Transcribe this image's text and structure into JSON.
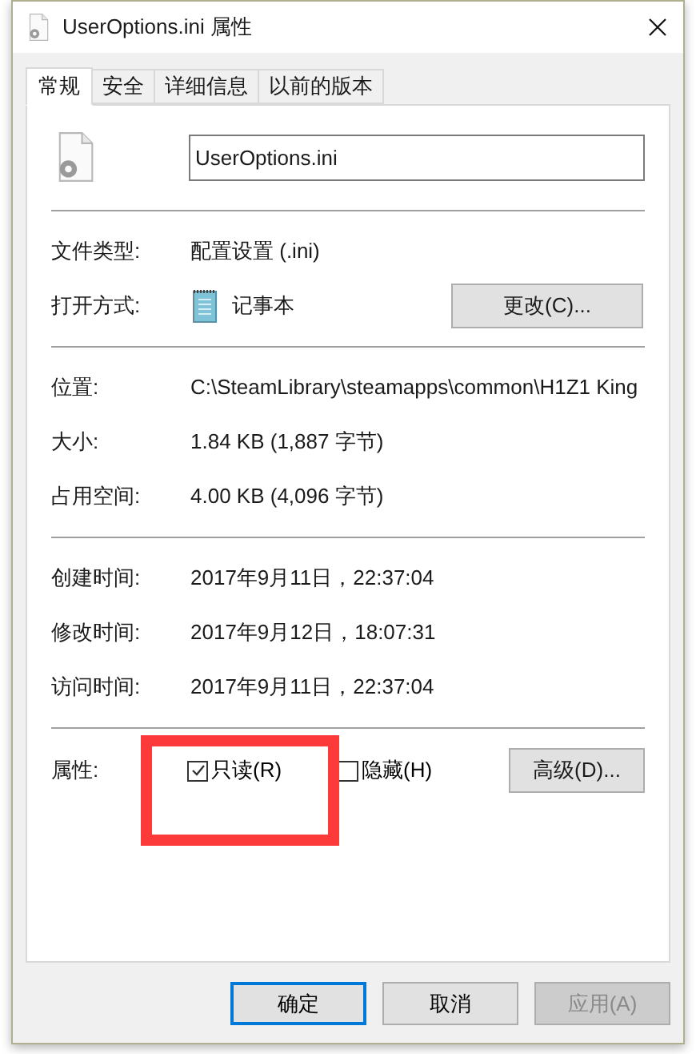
{
  "window": {
    "title": "UserOptions.ini 属性"
  },
  "tabs": [
    {
      "label": "常规",
      "selected": true
    },
    {
      "label": "安全",
      "selected": false
    },
    {
      "label": "详细信息",
      "selected": false
    },
    {
      "label": "以前的版本",
      "selected": false
    }
  ],
  "file_name": {
    "value": "UserOptions.ini"
  },
  "sections": [
    [
      {
        "kind": "text",
        "label": "文件类型:",
        "value": "配置设置 (.ini)"
      },
      {
        "kind": "app",
        "label": "打开方式:",
        "value": "记事本",
        "button": "更改(C)..."
      }
    ],
    [
      {
        "kind": "text",
        "label": "位置:",
        "value": "C:\\SteamLibrary\\steamapps\\common\\H1Z1 King"
      },
      {
        "kind": "text",
        "label": "大小:",
        "value": "1.84 KB (1,887 字节)"
      },
      {
        "kind": "text",
        "label": "占用空间:",
        "value": "4.00 KB (4,096 字节)"
      }
    ],
    [
      {
        "kind": "text",
        "label": "创建时间:",
        "value": "2017年9月11日，22:37:04"
      },
      {
        "kind": "text",
        "label": "修改时间:",
        "value": "2017年9月12日，18:07:31"
      },
      {
        "kind": "text",
        "label": "访问时间:",
        "value": "2017年9月11日，22:37:04"
      }
    ]
  ],
  "attributes": {
    "label": "属性:",
    "checkboxes": [
      {
        "label": "只读(R)",
        "checked": true
      },
      {
        "label": "隐藏(H)",
        "checked": false
      }
    ],
    "button": "高级(D)..."
  },
  "buttons": [
    {
      "label": "确定",
      "primary": true,
      "disabled": false
    },
    {
      "label": "取消",
      "primary": false,
      "disabled": false
    },
    {
      "label": "应用(A)",
      "primary": false,
      "disabled": true
    }
  ]
}
